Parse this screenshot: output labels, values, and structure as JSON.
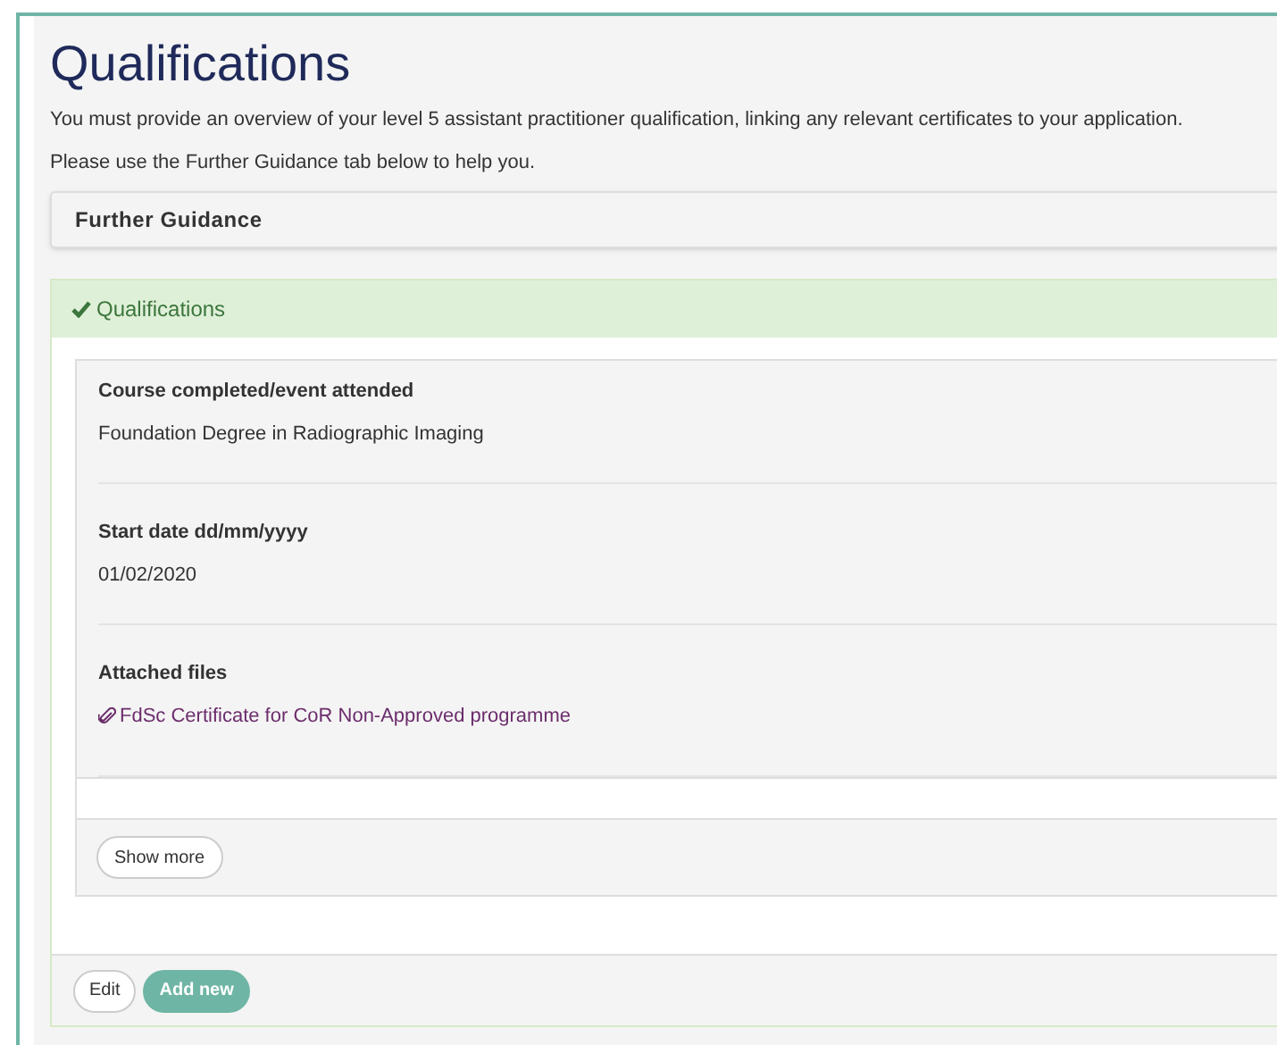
{
  "title": "Qualifications",
  "intro": [
    "You must provide an overview of your level 5 assistant practitioner qualification, linking any relevant certificates to your application.",
    "Please use the Further Guidance tab below to help you."
  ],
  "guidance": {
    "label": "Further Guidance"
  },
  "section": {
    "title": "Qualifications",
    "complete": true,
    "fields": [
      {
        "label": "Course completed/event attended",
        "value": "Foundation Degree in Radiographic Imaging",
        "kind": "text"
      },
      {
        "label": "Start date dd/mm/yyyy",
        "value": "01/02/2020",
        "kind": "text"
      },
      {
        "label": "Attached files",
        "value": "FdSc Certificate for CoR Non-Approved programme",
        "kind": "file"
      }
    ],
    "show_more": "Show more",
    "buttons": [
      {
        "label": "Edit",
        "kind": "secondary"
      },
      {
        "label": "Add new",
        "kind": "primary"
      }
    ]
  }
}
